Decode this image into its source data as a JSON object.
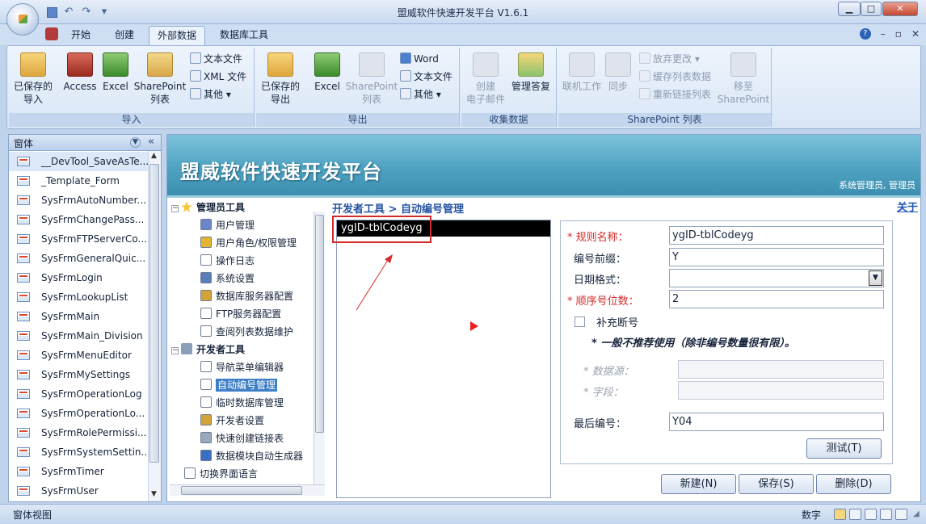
{
  "window": {
    "title": "盟威软件快速开发平台 V1.6.1"
  },
  "ribbon_tabs": [
    "开始",
    "创建",
    "外部数据",
    "数据库工具"
  ],
  "ribbon": {
    "import_group": {
      "name": "导入",
      "saved_import": "已保存的\n导入",
      "access": "Access",
      "excel": "Excel",
      "sharepoint_list": "SharePoint\n列表",
      "text_file": "文本文件",
      "xml_file": "XML 文件",
      "more": "其他"
    },
    "export_group": {
      "name": "导出",
      "saved_export": "已保存的\n导出",
      "excel": "Excel",
      "sharepoint_list": "SharePoint\n列表",
      "word": "Word",
      "text_file": "文本文件",
      "more": "其他"
    },
    "collect_group": {
      "name": "收集数据",
      "create_email": "创建\n电子邮件",
      "manage_replies": "管理答复"
    },
    "sharepoint_group": {
      "name": "SharePoint 列表",
      "work_offline": "联机工作",
      "sync": "同步",
      "discard_changes": "放弃更改",
      "cache_list_data": "缓存列表数据",
      "relink_lists": "重新链接列表",
      "move_to_sharepoint": "移至\nSharePoint"
    }
  },
  "nav_pane": {
    "title": "窗体",
    "items": [
      "__DevTool_SaveAsTe...",
      "_Template_Form",
      "SysFrmAutoNumber...",
      "SysFrmChangePass...",
      "SysFrmFTPServerCo...",
      "SysFrmGeneralQuic...",
      "SysFrmLogin",
      "SysFrmLookupList",
      "SysFrmMain",
      "SysFrmMain_Division",
      "SysFrmMenuEditor",
      "SysFrmMySettings",
      "SysFrmOperationLog",
      "SysFrmOperationLo...",
      "SysFrmRolePermissi...",
      "SysFrmSystemSettin...",
      "SysFrmTimer",
      "SysFrmUser"
    ]
  },
  "banner": {
    "title": "盟威软件快速开发平台",
    "user": "系统管理员, 管理员"
  },
  "tree": {
    "admin_tools": "管理员工具",
    "admin_items": [
      "用户管理",
      "用户角色/权限管理",
      "操作日志",
      "系统设置",
      "数据库服务器配置",
      "FTP服务器配置",
      "查阅列表数据维护"
    ],
    "dev_tools": "开发者工具",
    "dev_items": [
      "导航菜单编辑器",
      "自动编号管理",
      "临时数据库管理",
      "开发者设置",
      "快速创建链接表",
      "数据模块自动生成器"
    ],
    "switch_language": "切换界面语言"
  },
  "breadcrumb": "开发者工具 > 自动编号管理",
  "close_link": "关于",
  "rule_list": {
    "selected": "ygID-tblCodeyg"
  },
  "form": {
    "rule_name_label": "规则名称：",
    "rule_name_value": "ygID-tblCodeyg",
    "prefix_label": "编号前缀：",
    "prefix_value": "Y",
    "date_format_label": "日期格式：",
    "date_format_value": "",
    "digits_label": "顺序号位数：",
    "digits_value": "2",
    "fill_gap_label": "补充断号",
    "fill_gap_note": "* 一般不推荐使用（除非编号数量很有限）。",
    "datasource_label": "* 数据源：",
    "field_label": "* 字段：",
    "last_number_label": "最后编号：",
    "last_number_value": "Y04",
    "test_button": "测试(T)",
    "new_button": "新建(N)",
    "save_button": "保存(S)",
    "delete_button": "删除(D)"
  },
  "status_bar": {
    "left": "窗体视图",
    "mode": "数字"
  }
}
